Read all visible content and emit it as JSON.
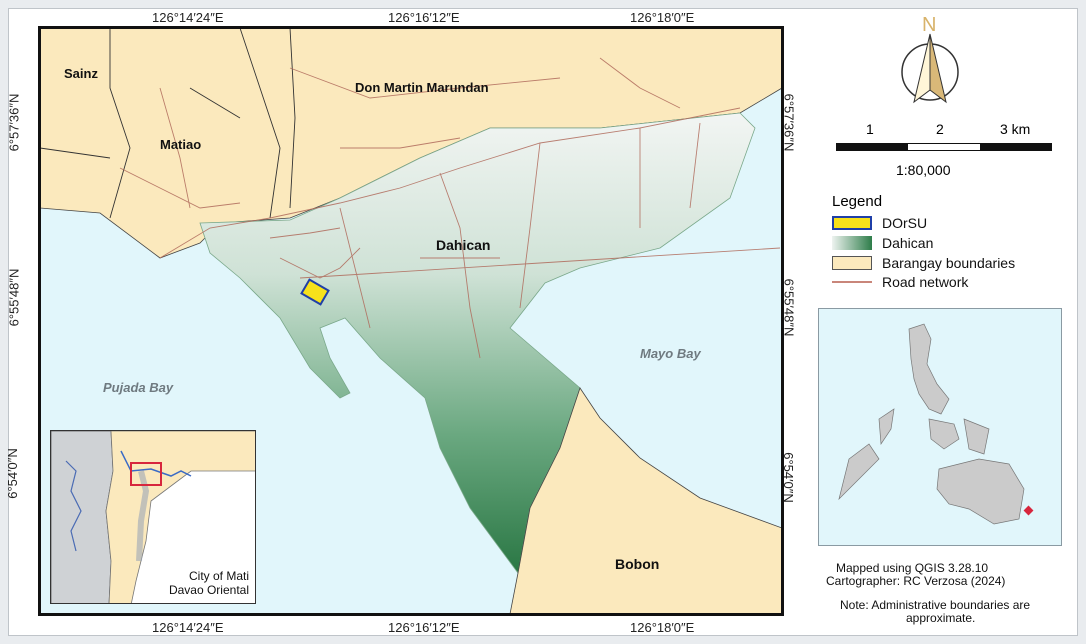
{
  "coords": {
    "top": [
      "126°14′24″E",
      "126°16′12″E",
      "126°18′0″E"
    ],
    "bottom": [
      "126°14′24″E",
      "126°16′12″E",
      "126°18′0″E"
    ],
    "left": [
      "6°57′36″N",
      "6°55′48″N",
      "6°54′0″N"
    ],
    "right": [
      "6°57′36″N",
      "6°55′48″N",
      "6°54′0″N"
    ]
  },
  "places": {
    "sainz": "Sainz",
    "matiao": "Matiao",
    "don_martin": "Don Martin Marundan",
    "dahican": "Dahican",
    "bobon": "Bobon"
  },
  "waters": {
    "pujada": "Pujada Bay",
    "mayo": "Mayo Bay"
  },
  "inset": {
    "line1": "City of Mati",
    "line2": "Davao Oriental"
  },
  "north_arrow": "N",
  "scale": {
    "ticks": [
      "1",
      "2",
      "3 km"
    ],
    "ratio": "1:80,000"
  },
  "legend": {
    "title": "Legend",
    "items": [
      {
        "label": "DOrSU",
        "color": "#f7e11b",
        "stroke": "#1f3fa8"
      },
      {
        "label": "Dahican",
        "color": "#3f8f5f",
        "stroke": "none"
      },
      {
        "label": "Barangay boundaries",
        "color": "#fbe9bd",
        "stroke": "#555"
      },
      {
        "label": "Road network",
        "color": "#c9867a",
        "stroke": "line"
      }
    ]
  },
  "credits": {
    "line1": "Mapped using QGIS 3.28.10",
    "line2": "Cartographer: RC Verzosa (2024)",
    "note1": "Note: Administrative boundaries are",
    "note2": "approximate."
  },
  "colors": {
    "water": "#e1f6fb",
    "land": "#fbe9bd",
    "dahican_dark": "#2e7d4a",
    "dahican_light": "#eef3f0",
    "road": "#b06b5c",
    "dorsu": "#f7e11b",
    "highlight": "#d7263d"
  }
}
